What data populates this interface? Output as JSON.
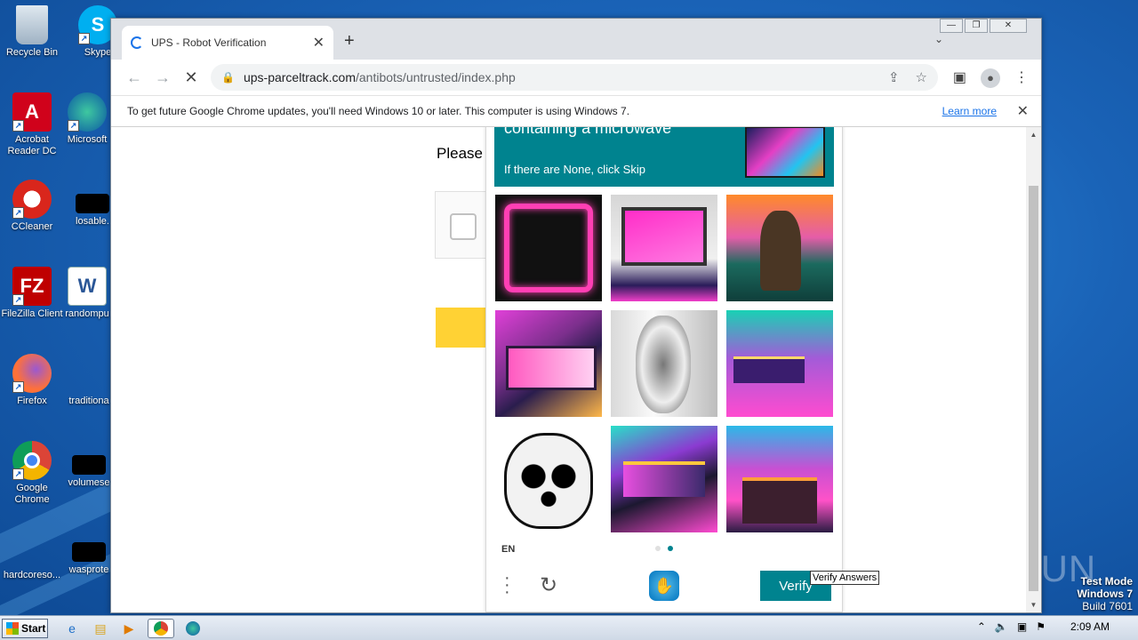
{
  "desktop": {
    "icons": [
      {
        "label": "Recycle Bin"
      },
      {
        "label": "Skype"
      },
      {
        "label": "Acrobat Reader DC"
      },
      {
        "label": "Microsoft"
      },
      {
        "label": "CCleaner"
      },
      {
        "label": "losable."
      },
      {
        "label": "FileZilla Client"
      },
      {
        "label": "randompu"
      },
      {
        "label": "Firefox"
      },
      {
        "label": "traditiona"
      },
      {
        "label": "Google Chrome"
      },
      {
        "label": "volumese"
      },
      {
        "label": "hardcoreso..."
      },
      {
        "label": "wasprote"
      }
    ],
    "watermark": "ANY RUN",
    "test_mode": {
      "line1": "Test Mode",
      "line2": "Windows 7",
      "line3": "Build 7601"
    }
  },
  "browser": {
    "tab_title": "UPS - Robot Verification",
    "url_host": "ups-parceltrack.com",
    "url_path": "/antibots/untrusted/index.php",
    "infobar_text": "To get future Google Chrome updates, you'll need Windows 10 or later. This computer is using Windows 7.",
    "infobar_link": "Learn more"
  },
  "page": {
    "please_text": "Please"
  },
  "captcha": {
    "prompt_fragment": "containing a microwave",
    "subtext": "If there are None, click Skip",
    "language": "EN",
    "verify_label": "Verify",
    "tooltip": "Verify Answers",
    "tiles": [
      "microwave-neon",
      "microwave-pink",
      "goat",
      "desk-pink",
      "violin",
      "desk-purple",
      "panda",
      "desk-laptop",
      "desk-neon"
    ],
    "page_indicator": {
      "current": 2,
      "total": 2
    }
  },
  "taskbar": {
    "start_label": "Start",
    "clock": "2:09 AM"
  },
  "colors": {
    "captcha_accent": "#00838f",
    "yellow_button": "#ffd234"
  }
}
